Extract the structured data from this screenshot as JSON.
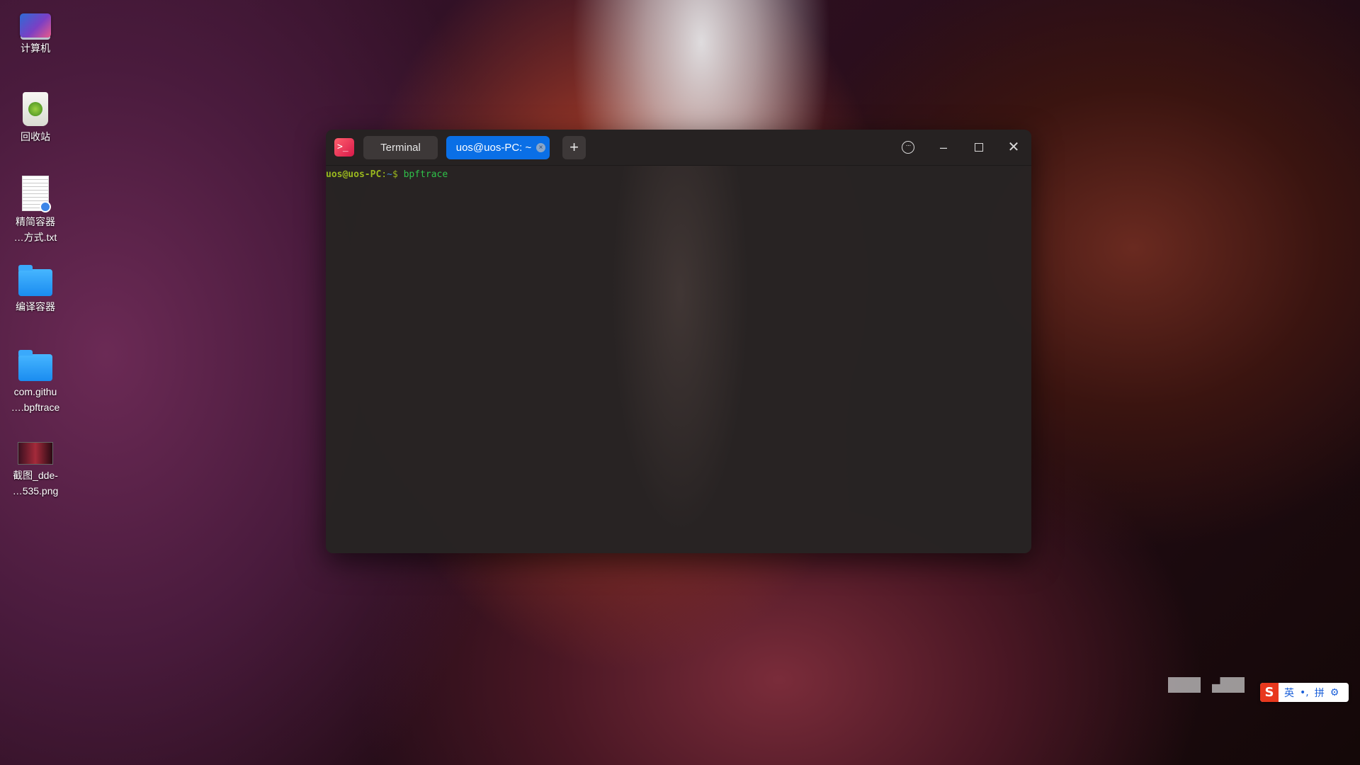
{
  "desktop": {
    "icons": [
      {
        "label": "计算机",
        "icon": "computer-icon"
      },
      {
        "label": "回收站",
        "icon": "trash-icon"
      },
      {
        "label": "精简容器\n…方式.txt",
        "icon": "text-file-icon"
      },
      {
        "label": "编译容器",
        "icon": "folder-icon"
      },
      {
        "label": "com.githu\n….bpftrace",
        "icon": "folder-icon"
      },
      {
        "label": "截图_dde-\n…535.png",
        "icon": "image-file-icon"
      }
    ]
  },
  "terminal": {
    "app_icon": ">_",
    "tabs": [
      {
        "label": "Terminal",
        "active": false
      },
      {
        "label": "uos@uos-PC: ~",
        "active": true
      }
    ],
    "new_tab": "+",
    "controls": {
      "menu": "···",
      "minimize": "–",
      "close": "✕"
    },
    "prompt": {
      "user_host": "uos@uos-PC",
      "colon": ":",
      "path": "~",
      "symbol": "$",
      "command": "bpftrace"
    }
  },
  "ime": {
    "logo": "S",
    "mode": "英",
    "punct": "•,",
    "input": "拼",
    "settings": "⚙"
  }
}
